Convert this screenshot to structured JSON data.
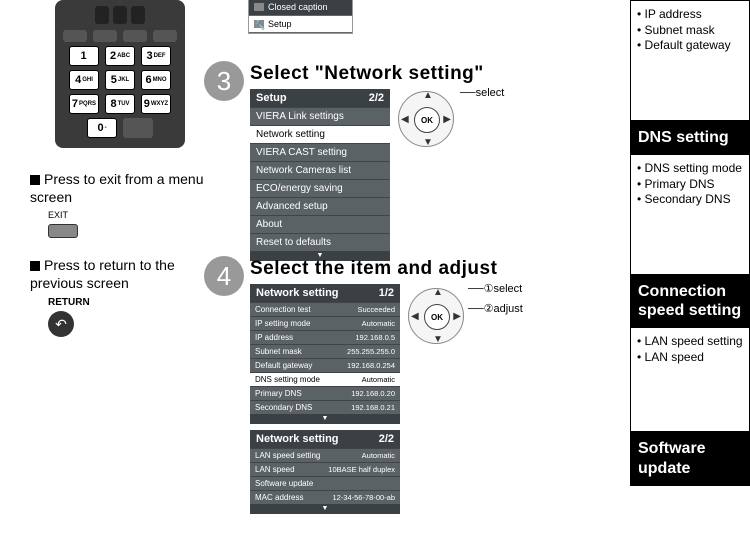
{
  "remote": {
    "keys": [
      {
        "n": "1",
        "s": ""
      },
      {
        "n": "2",
        "s": "ABC"
      },
      {
        "n": "3",
        "s": "DEF"
      },
      {
        "n": "4",
        "s": "GHI"
      },
      {
        "n": "5",
        "s": "JKL"
      },
      {
        "n": "6",
        "s": "MNO"
      },
      {
        "n": "7",
        "s": "PQRS"
      },
      {
        "n": "8",
        "s": "TUV"
      },
      {
        "n": "9",
        "s": "WXYZ"
      }
    ],
    "zero": {
      "n": "0",
      "s": "-"
    }
  },
  "instructions": {
    "exit_text": "Press to exit from a menu screen",
    "exit_label": "EXIT",
    "return_text": "Press to return to the previous screen",
    "return_label": "RETURN"
  },
  "top_small_menu": {
    "cc": "Closed caption",
    "setup": "Setup"
  },
  "step3": {
    "title": "Select \"Network setting\"",
    "header": "Setup",
    "page": "2/2",
    "items": [
      "VIERA Link settings",
      "Network setting",
      "VIERA CAST setting",
      "Network Cameras list",
      "ECO/energy saving",
      "Advanced setup",
      "About",
      "Reset to defaults"
    ],
    "selected_index": 1,
    "pointer_select": "select"
  },
  "step4": {
    "title": "Select the item and adjust",
    "pointer_select": "①select",
    "pointer_adjust": "②adjust",
    "menu_a": {
      "header": "Network setting",
      "page": "1/2",
      "rows": [
        {
          "label": "Connection test",
          "value": "Succeeded"
        },
        {
          "label": "IP setting mode",
          "value": "Automatic"
        },
        {
          "label": "IP address",
          "value": "192.168.0.5"
        },
        {
          "label": "Subnet mask",
          "value": "255.255.255.0"
        },
        {
          "label": "Default gateway",
          "value": "192.168.0.254"
        },
        {
          "label": "DNS setting mode",
          "value": "Automatic"
        },
        {
          "label": "Primary DNS",
          "value": "192.168.0.20"
        },
        {
          "label": "Secondary DNS",
          "value": "192.168.0.21"
        }
      ],
      "selected_index": 5
    },
    "menu_b": {
      "header": "Network setting",
      "page": "2/2",
      "rows": [
        {
          "label": "LAN speed setting",
          "value": "Automatic"
        },
        {
          "label": "LAN speed",
          "value": "10BASE half duplex"
        },
        {
          "label": "Software update",
          "value": ""
        },
        {
          "label": "MAC address",
          "value": "12-34-56-78-00-ab"
        }
      ]
    }
  },
  "sidebar": {
    "top_items": [
      "IP address",
      "Subnet mask",
      "Default gateway"
    ],
    "dns_title": "DNS setting",
    "dns_items": [
      "DNS setting mode",
      "Primary DNS",
      "Secondary DNS"
    ],
    "conn_title": "Connection speed setting",
    "conn_items": [
      "LAN speed setting",
      "LAN speed"
    ],
    "soft_title": "Software update"
  }
}
